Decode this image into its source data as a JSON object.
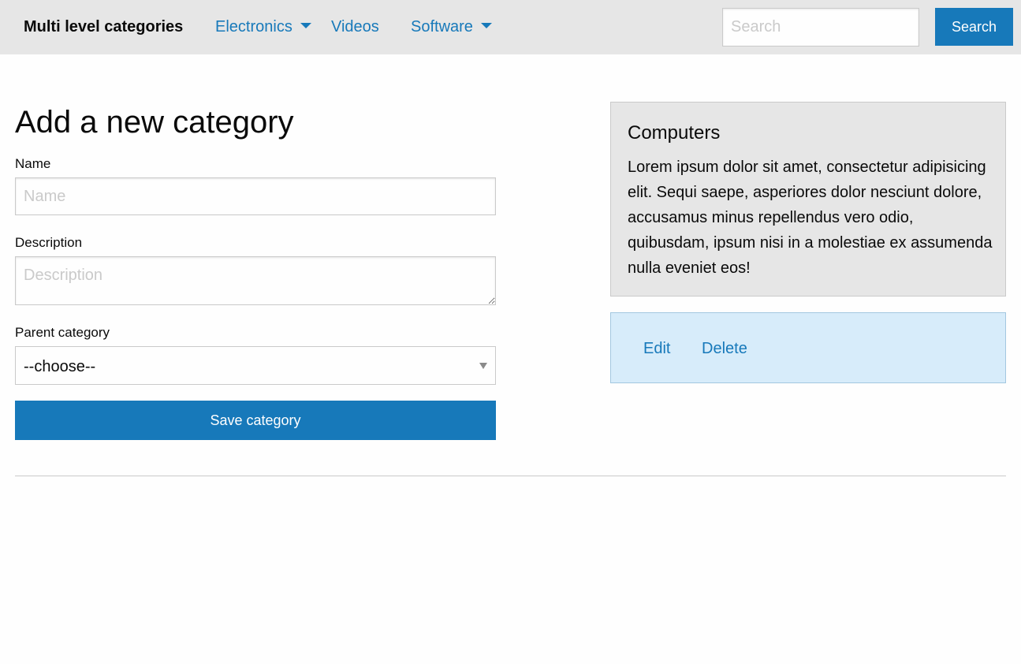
{
  "topbar": {
    "brand": "Multi level categories",
    "nav": [
      {
        "label": "Electronics",
        "has_dropdown": true
      },
      {
        "label": "Videos",
        "has_dropdown": false
      },
      {
        "label": "Software",
        "has_dropdown": true
      }
    ],
    "search_placeholder": "Search",
    "search_button": "Search"
  },
  "form": {
    "title": "Add a new category",
    "name_label": "Name",
    "name_placeholder": "Name",
    "description_label": "Description",
    "description_placeholder": "Description",
    "parent_label": "Parent category",
    "parent_selected": "--choose--",
    "save_button": "Save category"
  },
  "category_card": {
    "title": "Computers",
    "body": "Lorem ipsum dolor sit amet, consectetur adipisicing elit. Sequi saepe, asperiores dolor nesciunt dolore, accusamus minus repellendus vero odio, quibusdam, ipsum nisi in a molestiae ex assumenda nulla eveniet eos!"
  },
  "actions": {
    "edit": "Edit",
    "delete": "Delete"
  },
  "colors": {
    "accent": "#1779ba",
    "topbar_bg": "#e6e6e6",
    "card_bg": "#e6e6e6",
    "actions_bg": "#d7ecfa"
  },
  "icons": {
    "dropdown": "caret-down-icon",
    "select": "select-arrow-icon"
  }
}
